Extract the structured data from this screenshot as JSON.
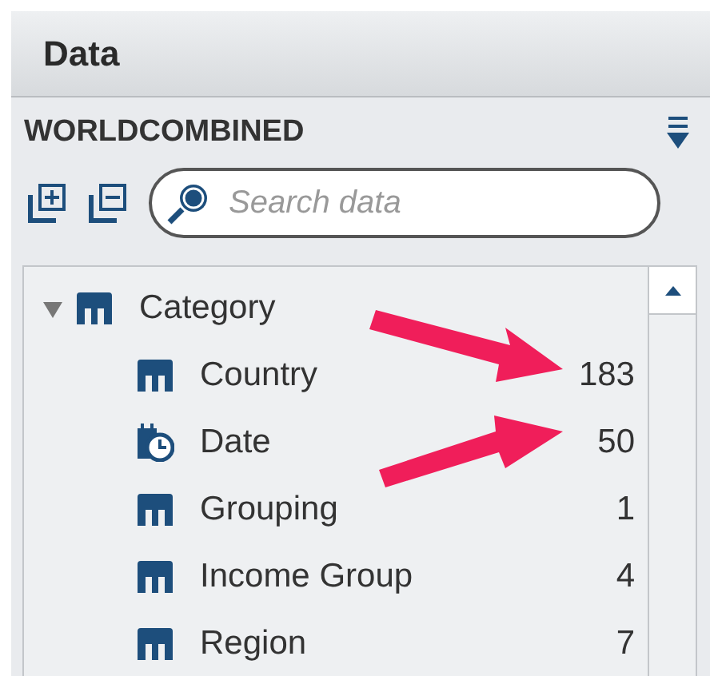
{
  "panel": {
    "title": "Data"
  },
  "source": {
    "name": "WORLDCOMBINED"
  },
  "search": {
    "placeholder": "Search data"
  },
  "tree": [
    {
      "label": "Category",
      "kind": "folder",
      "expanded": true,
      "children": [
        {
          "label": "Country",
          "kind": "category",
          "count": "183"
        },
        {
          "label": "Date",
          "kind": "date",
          "count": "50"
        },
        {
          "label": "Grouping",
          "kind": "category",
          "count": "1"
        },
        {
          "label": "Income Group",
          "kind": "category",
          "count": "4"
        },
        {
          "label": "Region",
          "kind": "category",
          "count": "7"
        }
      ]
    }
  ]
}
